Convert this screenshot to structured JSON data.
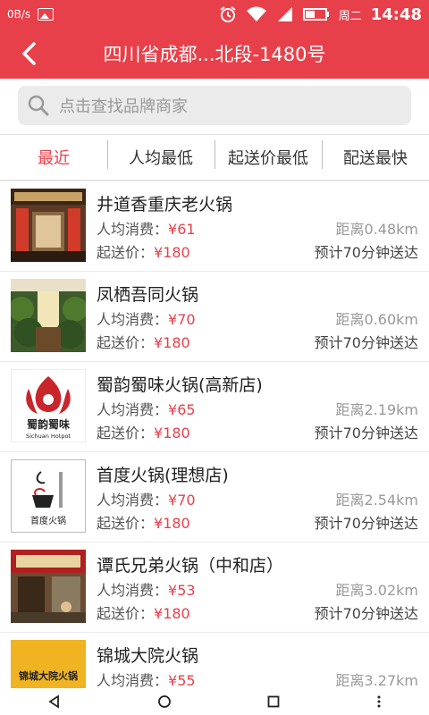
{
  "status_bar": {
    "net_speed": "0B/s",
    "day": "周二",
    "time": "14:48"
  },
  "header": {
    "title": "四川省成都...北段-1480号"
  },
  "search": {
    "placeholder": "点击查找品牌商家"
  },
  "tabs": [
    {
      "label": "最近",
      "active": true
    },
    {
      "label": "人均最低",
      "active": false
    },
    {
      "label": "起送价最低",
      "active": false
    },
    {
      "label": "配送最快",
      "active": false
    }
  ],
  "list_labels": {
    "per_capita": "人均消费：",
    "min_order": "起送价："
  },
  "restaurants": [
    {
      "name": "井道香重庆老火锅",
      "price": "¥61",
      "min_order": "¥180",
      "distance": "距离0.48km",
      "eta": "预计70分钟送达"
    },
    {
      "name": "凤栖吾同火锅",
      "price": "¥70",
      "min_order": "¥180",
      "distance": "距离0.60km",
      "eta": "预计70分钟送达"
    },
    {
      "name": "蜀韵蜀味火锅(高新店)",
      "price": "¥65",
      "min_order": "¥180",
      "distance": "距离2.19km",
      "eta": "预计70分钟送达",
      "logo_text": "蜀韵蜀味",
      "logo_sub": "Sichuan Hotpot"
    },
    {
      "name": "首度火锅(理想店)",
      "price": "¥70",
      "min_order": "¥180",
      "distance": "距离2.54km",
      "eta": "预计70分钟送达",
      "logo_text": "首度火锅"
    },
    {
      "name": "谭氏兄弟火锅（中和店）",
      "price": "¥53",
      "min_order": "¥180",
      "distance": "距离3.02km",
      "eta": "预计70分钟送达"
    },
    {
      "name": "锦城大院火锅",
      "price": "¥55",
      "distance": "距离3.27km",
      "logo_text": "锦城大院火锅"
    }
  ],
  "colors": {
    "accent": "#e8404a"
  }
}
